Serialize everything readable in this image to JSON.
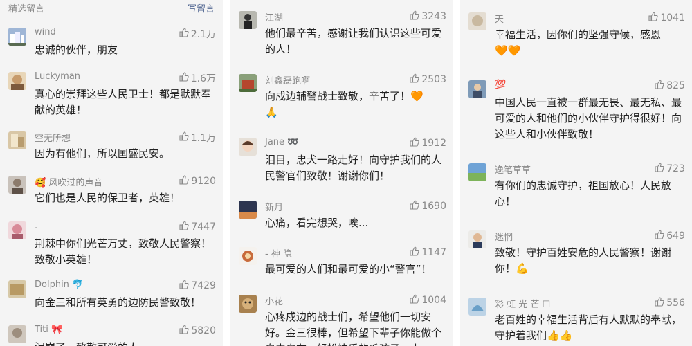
{
  "header": {
    "label": "精选留言",
    "write": "写留言"
  },
  "icons": {
    "like": "thumbs-up-icon"
  },
  "col1": [
    {
      "name": "wind",
      "likes": "2.1万",
      "text": "忠诚的伙伴，朋友"
    },
    {
      "name": "Luckyman",
      "likes": "1.6万",
      "text": "真心的崇拜这些人民卫士！都是默默奉献的英雄！"
    },
    {
      "name": "空无所想",
      "likes": "1.1万",
      "text": "因为有他们，所以国盛民安。"
    },
    {
      "name": "风吹过的声音",
      "likes": "9120",
      "text": "它们也是人民的保卫者，英雄！"
    },
    {
      "name": ".",
      "likes": "7447",
      "text": "荆棘中你们光芒万丈，致敬人民警察！致敬小英雄！"
    },
    {
      "name": "Dolphin",
      "likes": "7429",
      "text": "向金三和所有英勇的边防民警致敬！"
    },
    {
      "name": "Titi",
      "likes": "5820",
      "text": "泪崩了，致敬可爱的人"
    }
  ],
  "col2": [
    {
      "name": "江湖",
      "likes": "3243",
      "text": "他们最辛苦，感谢让我们认识这些可爱的人！"
    },
    {
      "name": "刘鑫磊跑啊",
      "likes": "2503",
      "text": "向戍边辅警战士致敬，辛苦了！"
    },
    {
      "name": "Jane",
      "likes": "1912",
      "text": "泪目，忠犬一路走好！向守护我们的人民警官们致敬！谢谢你们！"
    },
    {
      "name": "新月",
      "likes": "1690",
      "text": "心痛，看完想哭，唉..."
    },
    {
      "name": "- 神 隐",
      "likes": "1147",
      "text": "最可爱的人们和最可爱的小“警官”！"
    },
    {
      "name": "小花",
      "likes": "1004",
      "text": "心疼戍边的战士们，希望他们一切安好。金三很棒，但希望下辈子你能做个自由自在、轻松快乐的毛孩子。走"
    }
  ],
  "col3": [
    {
      "name": "天",
      "likes": "1041",
      "text": "幸福生活，因你们的坚强守候，感恩"
    },
    {
      "name": "💯",
      "likes": "825",
      "text": "中国人民一直被一群最无畏、最无私、最可爱的人和他们的小伙伴守护得很好！向这些人和小伙伴致敬！"
    },
    {
      "name": "逸笔草草",
      "likes": "723",
      "text": "有你们的忠诚守护，祖国放心！人民放心！"
    },
    {
      "name": "迷惘",
      "likes": "649",
      "text": "致敬！守护百姓安危的人民警察！谢谢你！"
    },
    {
      "name": "彩 虹 光 芒 ☐",
      "likes": "556",
      "text": "老百姓的幸福生活背后有人默默的奉献，守护着我们"
    }
  ]
}
